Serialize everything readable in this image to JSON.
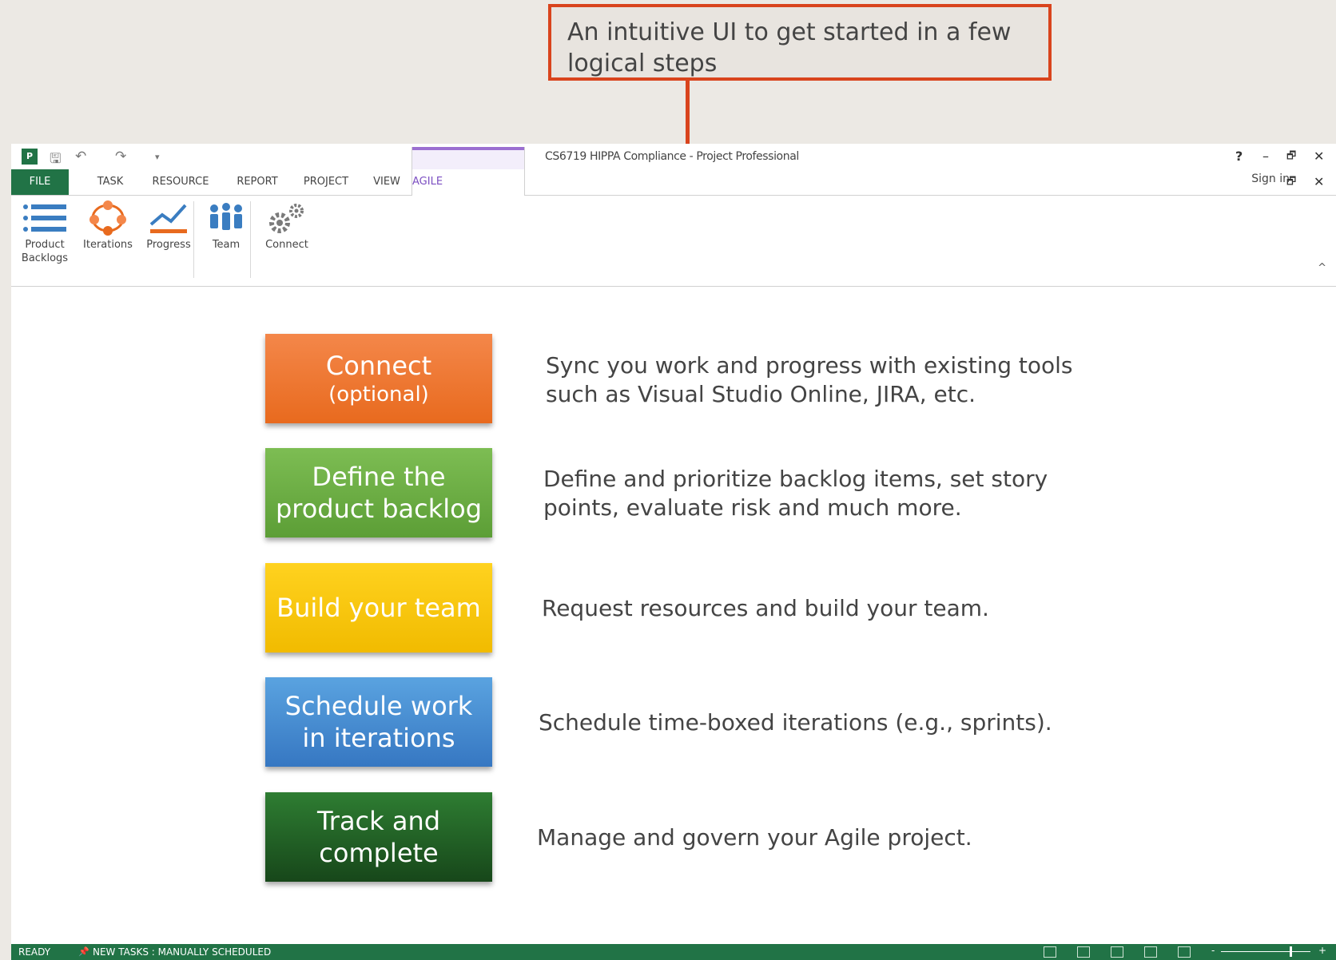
{
  "callout": {
    "text": "An intuitive UI to get started in a few logical steps"
  },
  "window": {
    "title": "CS6719 HIPPA Compliance - Project Professional",
    "controls": {
      "help": "?",
      "minimize": "–",
      "restore": "🗗",
      "close": "✕",
      "ribbon_restore": "🗗",
      "ribbon_close": "✕"
    },
    "sign_in": "Sign in",
    "quick_access": {
      "app": "P",
      "save": "🖫",
      "undo": "↶",
      "redo": "↷",
      "customize": "▾"
    }
  },
  "tabs": [
    {
      "label": "FILE"
    },
    {
      "label": "TASK"
    },
    {
      "label": "RESOURCE"
    },
    {
      "label": "REPORT"
    },
    {
      "label": "PROJECT"
    },
    {
      "label": "VIEW"
    },
    {
      "label": "AGILE"
    }
  ],
  "ribbon": {
    "buttons": [
      {
        "label1": "Product",
        "label2": "Backlogs",
        "icon": "backlog-list-icon"
      },
      {
        "label1": "Iterations",
        "label2": "",
        "icon": "iterations-cycle-icon"
      },
      {
        "label1": "Progress",
        "label2": "",
        "icon": "progress-chart-icon"
      },
      {
        "label1": "Team",
        "label2": "",
        "icon": "team-people-icon"
      },
      {
        "label1": "Connect",
        "label2": "",
        "icon": "connect-gears-icon"
      }
    ],
    "collapse_glyph": "^"
  },
  "steps": [
    {
      "title": "Connect",
      "sub": "(optional)",
      "color_top": "#f4874a",
      "color_bottom": "#e86a1e",
      "desc": [
        "Sync you work and progress with existing tools",
        "such as Visual Studio Online, JIRA, etc."
      ]
    },
    {
      "title": "Define the",
      "title2": "product backlog",
      "color_top": "#7dbd53",
      "color_bottom": "#5c9e36",
      "desc": [
        "Define and prioritize backlog items, set story",
        "points, evaluate risk and much more."
      ]
    },
    {
      "title": "Build your team",
      "color_top": "#ffd21f",
      "color_bottom": "#f1bb00",
      "desc": [
        "Request resources and build your team."
      ]
    },
    {
      "title": "Schedule work",
      "title2": "in iterations",
      "color_top": "#5aa3e0",
      "color_bottom": "#3677c2",
      "desc": [
        "Schedule time-boxed iterations (e.g., sprints)."
      ]
    },
    {
      "title": "Track and",
      "title2": "complete",
      "color_top": "#2e7d32",
      "color_bottom": "#17471a",
      "desc": [
        "Manage and govern your Agile project."
      ]
    }
  ],
  "statusbar": {
    "ready": "READY",
    "new_tasks": "NEW TASKS : MANUALLY SCHEDULED",
    "pin_glyph": "📌"
  }
}
